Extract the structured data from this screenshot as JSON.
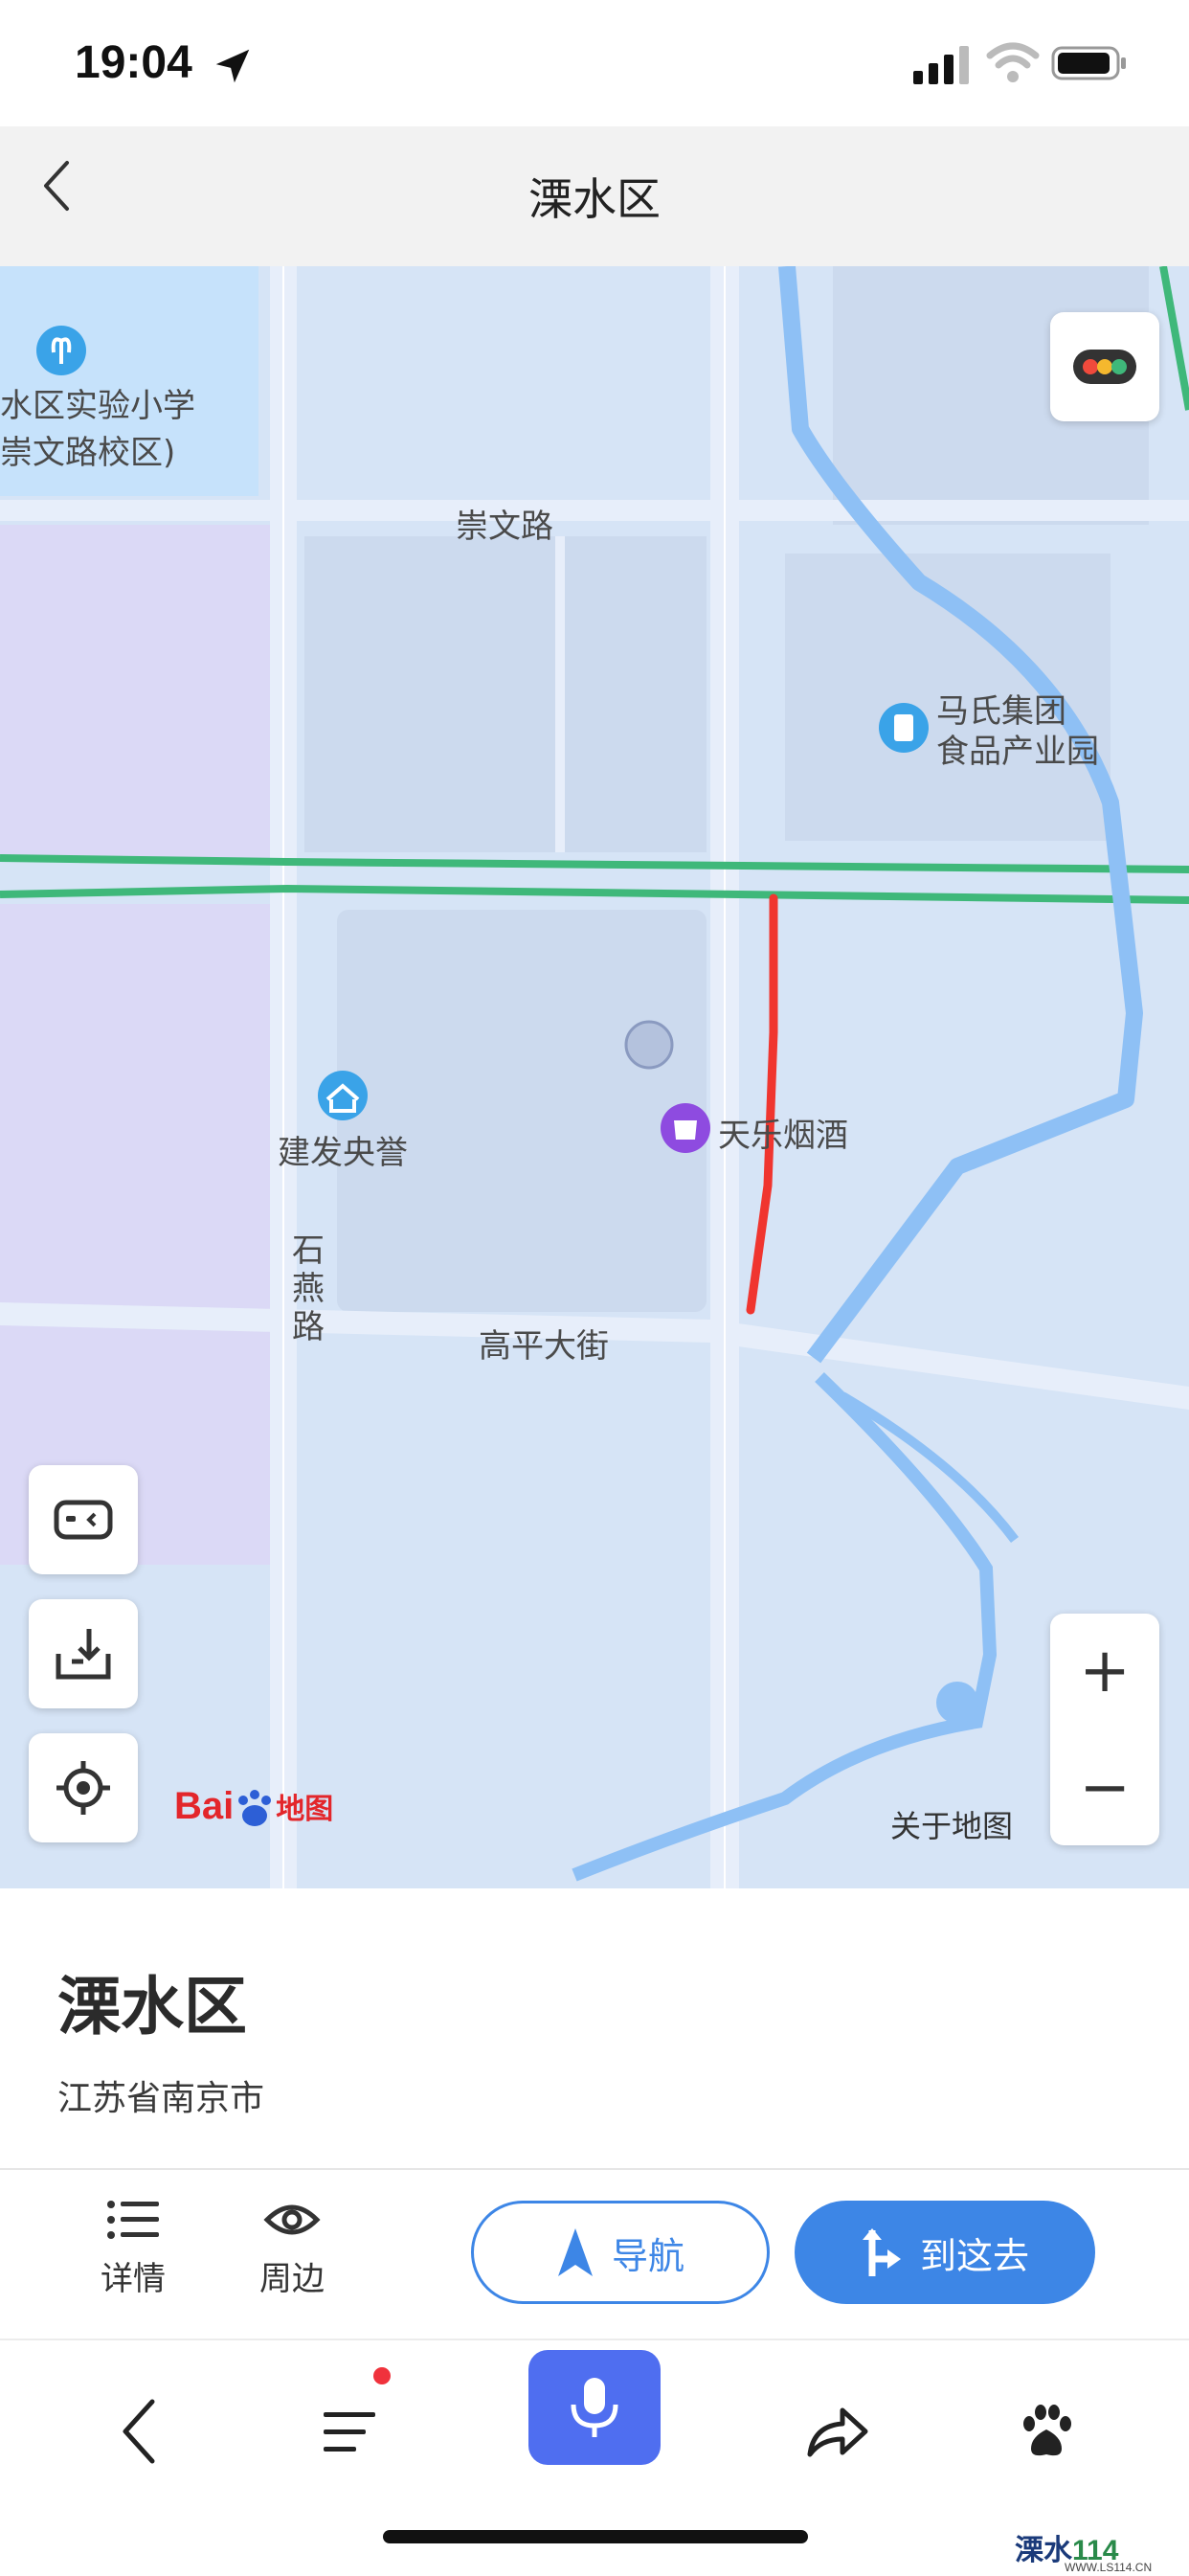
{
  "status_bar": {
    "time": "19:04",
    "icons": [
      "location-arrow-icon",
      "cellular-signal-icon",
      "wifi-icon",
      "battery-icon"
    ]
  },
  "header": {
    "title": "溧水区",
    "back_icon": "chevron-left-icon"
  },
  "map": {
    "roads": {
      "chongwen": "崇文路",
      "gaoping": "高平大街",
      "shiyan": "石燕路"
    },
    "pois": {
      "school_line1": "水区实验小学",
      "school_line2": "崇文路校区)",
      "mashi_line1": "马氏集团",
      "mashi_line2": "食品产业园",
      "jianfa": "建发央誉",
      "tianle": "天乐烟酒"
    },
    "about_map": "关于地图",
    "logo_text": "Bai",
    "logo_suffix": "地图",
    "zoom_in": "+",
    "zoom_out": "−",
    "controls": [
      "traffic-light-icon",
      "vr-glasses-icon",
      "offline-download-icon",
      "locate-icon"
    ],
    "colors": {
      "route": "#f0352f",
      "road_green": "#3fb87a",
      "water": "#8ec0f5"
    }
  },
  "place": {
    "name": "溧水区",
    "address": "江苏省南京市"
  },
  "actions": {
    "details": "详情",
    "nearby": "周边",
    "navigate": "导航",
    "go_here": "到这去"
  },
  "bottom_nav": {
    "icons": [
      "back-arrow-icon",
      "menu-icon",
      "microphone-icon",
      "share-icon",
      "baidu-paw-icon"
    ]
  },
  "watermark": {
    "brand": "溧水",
    "num": "114",
    "site": "WWW.LS114.CN"
  }
}
